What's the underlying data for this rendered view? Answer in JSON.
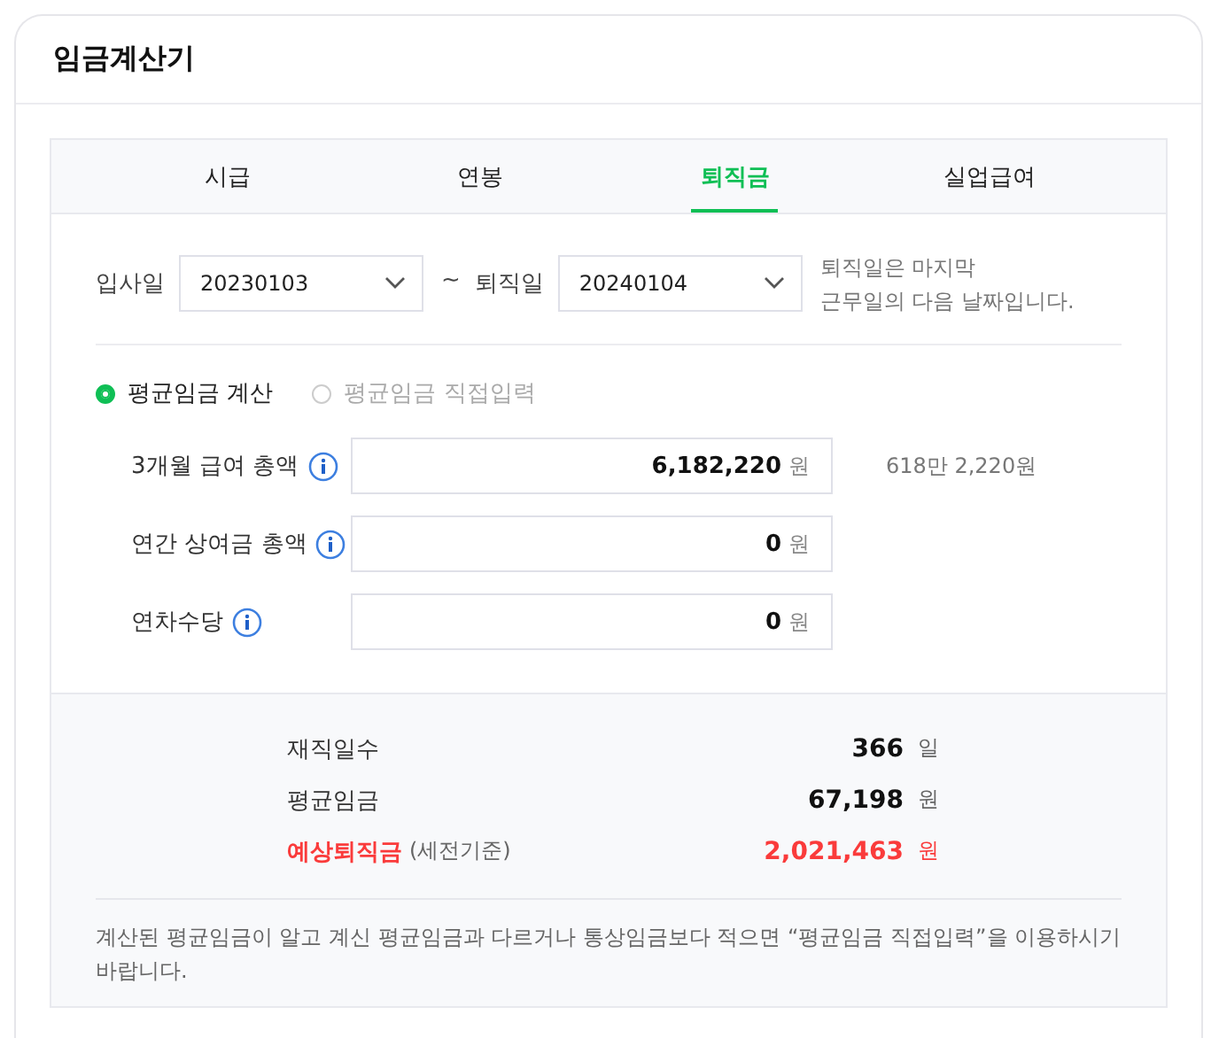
{
  "title": "임금계산기",
  "tabs": [
    {
      "label": "시급",
      "selected": false
    },
    {
      "label": "연봉",
      "selected": false
    },
    {
      "label": "퇴직금",
      "selected": true
    },
    {
      "label": "실업급여",
      "selected": false
    }
  ],
  "dates": {
    "start_label": "입사일",
    "start_value": "20230103",
    "separator": "~",
    "end_label": "퇴직일",
    "end_value": "20240104",
    "hint": "퇴직일은 마지막\n근무일의 다음 날짜입니다."
  },
  "modes": [
    {
      "label": "평균임금 계산",
      "selected": true
    },
    {
      "label": "평균임금 직접입력",
      "selected": false
    }
  ],
  "inputs": [
    {
      "label": "3개월 급여 총액",
      "value": "6,182,220",
      "unit": "원",
      "reading": "618만 2,220원"
    },
    {
      "label": "연간 상여금 총액",
      "value": "0",
      "unit": "원"
    },
    {
      "label": "연차수당",
      "value": "0",
      "unit": "원"
    }
  ],
  "results": [
    {
      "kind": "normal",
      "label": "재직일수",
      "value": "366",
      "unit": "일"
    },
    {
      "kind": "normal",
      "label": "평균임금",
      "value": "67,198",
      "unit": "원"
    },
    {
      "kind": "total",
      "label": "예상퇴직금",
      "note": "(세전기준)",
      "value": "2,021,463",
      "unit": "원"
    }
  ],
  "notice": "계산된 평균임금이 알고 계신 평균임금과 다르거나 통상임금보다 적으면 “평균임금 직접입력”을 이용하시기 바랍니다."
}
